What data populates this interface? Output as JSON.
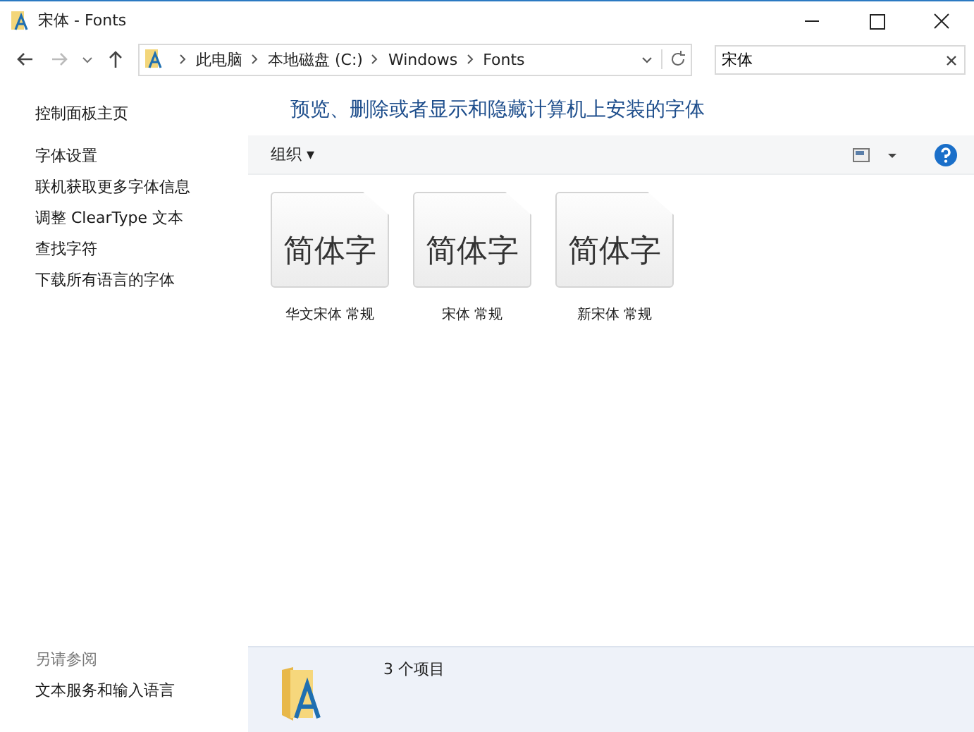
{
  "window": {
    "title": "宋体 - Fonts"
  },
  "address_bar": {
    "breadcrumbs": [
      "此电脑",
      "本地磁盘 (C:)",
      "Windows",
      "Fonts"
    ]
  },
  "search": {
    "value": "宋体"
  },
  "sidebar": {
    "items": [
      {
        "label": "控制面板主页",
        "kind": "home"
      },
      {
        "label": "字体设置",
        "kind": "link"
      },
      {
        "label": "联机获取更多字体信息",
        "kind": "link"
      },
      {
        "label": "调整 ClearType 文本",
        "kind": "link"
      },
      {
        "label": "查找字符",
        "kind": "link"
      },
      {
        "label": "下载所有语言的字体",
        "kind": "link"
      }
    ],
    "see_also": {
      "heading": "另请参阅",
      "items": [
        "文本服务和输入语言"
      ]
    }
  },
  "heading": "预览、删除或者显示和隐藏计算机上安装的字体",
  "toolbar": {
    "organize": "组织 ▾"
  },
  "fonts": [
    {
      "preview": "简体字",
      "name": "华文宋体 常规"
    },
    {
      "preview": "简体字",
      "name": "宋体 常规"
    },
    {
      "preview": "简体字",
      "name": "新宋体 常规"
    }
  ],
  "details": {
    "count": "3 个项目"
  }
}
